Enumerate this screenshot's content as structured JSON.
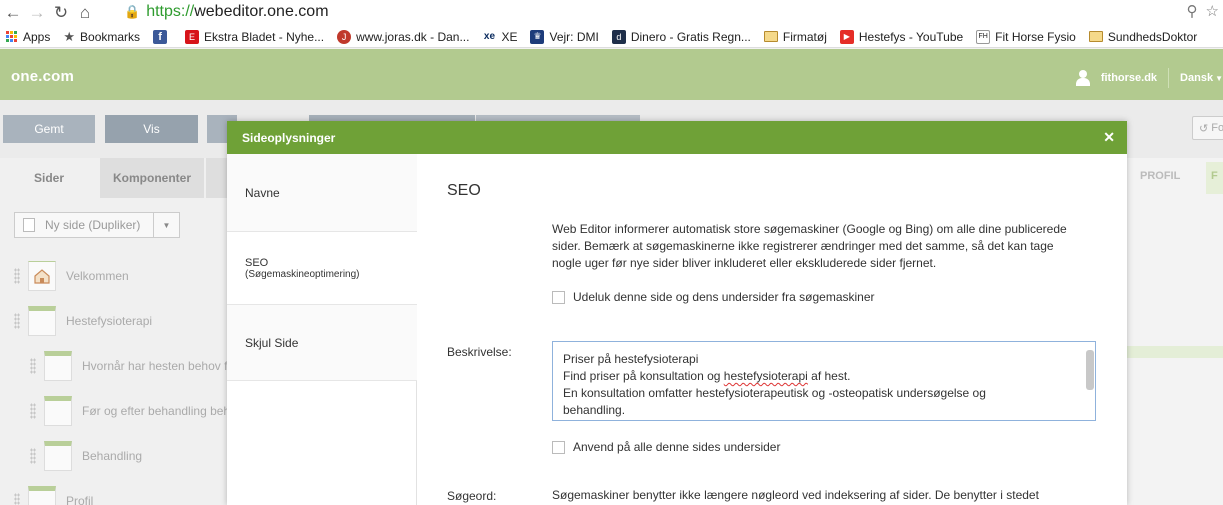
{
  "browser": {
    "url_scheme": "https://",
    "url_host": "webeditor.one.com",
    "bookmarks": [
      {
        "label": "Apps",
        "icon": "apps-grid-icon"
      },
      {
        "label": "Bookmarks",
        "icon": "star-icon"
      },
      {
        "label": "",
        "icon": "facebook-icon"
      },
      {
        "label": "Ekstra Bladet - Nyhe...",
        "icon": "ekstrabladet-icon"
      },
      {
        "label": "www.joras.dk - Dan...",
        "icon": "joras-icon"
      },
      {
        "label": "XE",
        "icon": "xe-icon"
      },
      {
        "label": "Vejr: DMI",
        "icon": "dmi-icon"
      },
      {
        "label": "Dinero - Gratis Regn...",
        "icon": "dinero-icon"
      },
      {
        "label": "Firmatøj",
        "icon": "folder-icon"
      },
      {
        "label": "Hestefys - YouTube",
        "icon": "youtube-icon"
      },
      {
        "label": "Fit Horse Fysio",
        "icon": "fithorse-icon"
      },
      {
        "label": "SundhedsDoktor",
        "icon": "folder-icon"
      }
    ]
  },
  "app": {
    "logo": "one.com",
    "user": "fithorse.dk",
    "language": "Dansk",
    "brand_color": "#b2ca8f"
  },
  "toolbar": {
    "saved": "Gemt",
    "view": "Vis",
    "right_btn": "Fo"
  },
  "left_panel": {
    "tabs": [
      "Sider",
      "Komponenter"
    ],
    "new_page": "Ny side (Dupliker)",
    "pages": [
      {
        "label": "Velkommen"
      },
      {
        "label": "Hestefysioterapi"
      },
      {
        "label": "Hvornår har hesten behov fo"
      },
      {
        "label": "Før og efter behandling beha"
      },
      {
        "label": "Behandling"
      },
      {
        "label": "Profil"
      }
    ]
  },
  "right_strip": {
    "profil_tab": "PROFIL",
    "green_tab": "F"
  },
  "modal": {
    "title": "Sideoplysninger",
    "header_color": "#6fa137",
    "nav": {
      "names": "Navne",
      "seo": "SEO",
      "seo_sub": "(Søgemaskineoptimering)",
      "hide": "Skjul Side"
    },
    "seo": {
      "heading": "SEO",
      "info": "Web Editor informerer automatisk store søgemaskiner (Google og Bing) om alle dine publicerede sider. Bemærk at søgemaskinerne ikke registrerer ændringer med det samme, så det kan tage nogle uger før nye sider bliver inkluderet eller ekskluderede sider fjernet.",
      "exclude_label": "Udeluk denne side og dens undersider fra søgemaskiner",
      "description_label": "Beskrivelse:",
      "description_lines": [
        "Priser på hestefysioterapi",
        "Find priser på konsultation og ",
        "hestefysioterapi",
        " af hest.",
        "En konsultation omfatter hestefysioterapeutisk og -osteopatisk undersøgelse og",
        "behandling."
      ],
      "apply_label": "Anvend på alle denne sides undersider",
      "keywords_label": "Søgeord:",
      "keywords_text": "Søgemaskiner benytter ikke længere nøgleord ved indeksering af sider. De benytter i stedet"
    }
  }
}
